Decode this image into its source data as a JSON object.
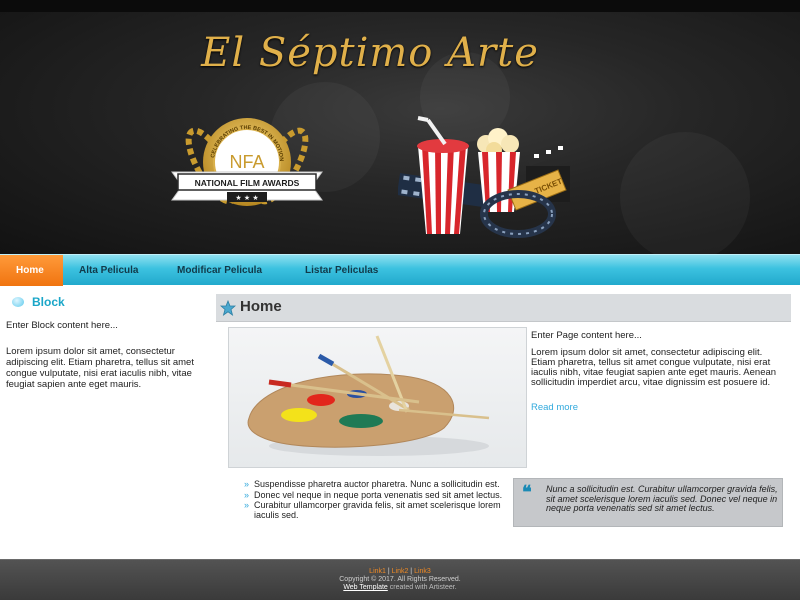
{
  "header": {
    "site_title": "El Séptimo Arte",
    "logo": {
      "ring_text": "CELEBRATING THE BEST IN MOTION PICTURE",
      "initials": "NFA",
      "ribbon": "NATIONAL FILM AWARDS",
      "stars": "★ ★ ★"
    },
    "ticket_text": "TICKET"
  },
  "nav": {
    "items": [
      {
        "label": "Home",
        "active": true
      },
      {
        "label": "Alta Pelicula",
        "active": false
      },
      {
        "label": "Modificar Pelicula",
        "active": false
      },
      {
        "label": "Listar Peliculas",
        "active": false
      }
    ]
  },
  "sidebar": {
    "block_title": "Block",
    "intro": "Enter Block content here...",
    "body": "Lorem ipsum dolor sit amet, consectetur adipiscing elit. Etiam pharetra, tellus sit amet congue vulputate, nisi erat iaculis nibh, vitae feugiat sapien ante eget mauris."
  },
  "main": {
    "title": "Home",
    "intro": "Enter Page content here...",
    "body": "Lorem ipsum dolor sit amet, consectetur adipiscing elit. Etiam pharetra, tellus sit amet congue vulputate, nisi erat iaculis nibh, vitae feugiat sapien ante eget mauris. Aenean sollicitudin imperdiet arcu, vitae dignissim est posuere id.",
    "read_more": "Read more",
    "bullets": [
      "Suspendisse pharetra auctor pharetra. Nunc a sollicitudin est.",
      "Donec vel neque in neque porta venenatis sed sit amet lectus.",
      "Curabitur ullamcorper gravida felis, sit amet scelerisque lorem iaculis sed."
    ],
    "bullet_glyph": "»",
    "quote_mark": "❝",
    "quote": "Nunc a sollicitudin est. Curabitur ullamcorper gravida felis, sit amet scelerisque lorem iaculis sed. Donec vel neque in neque porta venenatis sed sit amet lectus."
  },
  "footer": {
    "links": [
      "Link1",
      "Link2",
      "Link3"
    ],
    "separator": " | ",
    "copyright": "Copyright © 2017. All Rights Reserved.",
    "credit_link": "Web Template",
    "credit_suffix": " created with Artisteer."
  },
  "colors": {
    "accent_orange": "#f07410",
    "accent_blue": "#33aadd",
    "title_gold": "#e0b04a"
  }
}
